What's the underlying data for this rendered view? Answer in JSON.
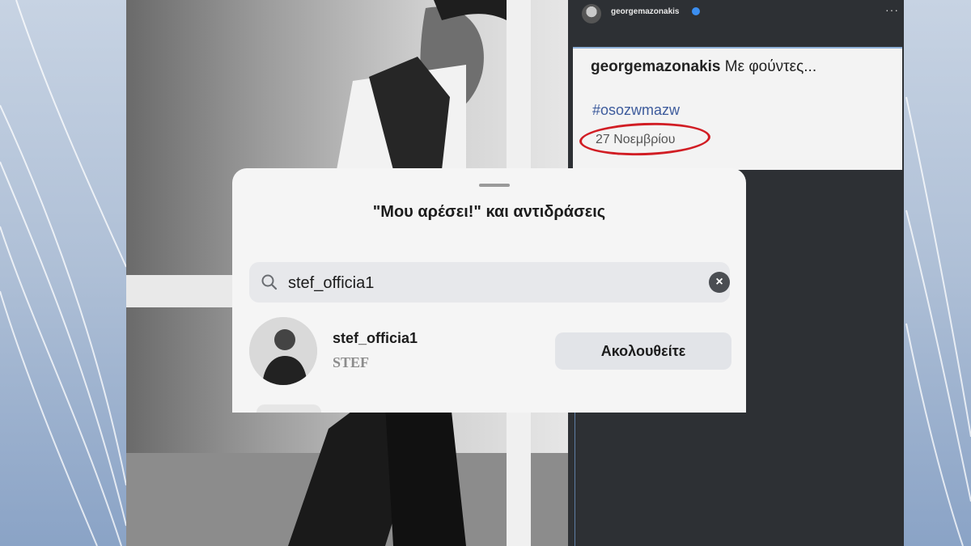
{
  "post": {
    "username": "georgemazonakis",
    "caption_user": "georgemazonakis",
    "caption_text": "Με φούντες...",
    "hashtag": "#osozwmazw",
    "date": "27 Νοεμβρίου",
    "more_icon": "more-dots-icon",
    "verified_icon": "verified-badge-icon"
  },
  "likes_sheet": {
    "title": "\"Μου αρέσει!\" και αντιδράσεις",
    "search": {
      "value": "stef_officia1",
      "icon": "search-icon",
      "clear_icon": "clear-icon"
    },
    "results": [
      {
        "username": "stef_officia1",
        "full_name": "STEF",
        "button_label": "Ακολουθείτε"
      }
    ]
  },
  "colors": {
    "highlight_circle": "#d11d24",
    "hashtag": "#3d5b9c",
    "panel_dark": "#2d3034",
    "sheet_bg": "#f5f5f5"
  }
}
